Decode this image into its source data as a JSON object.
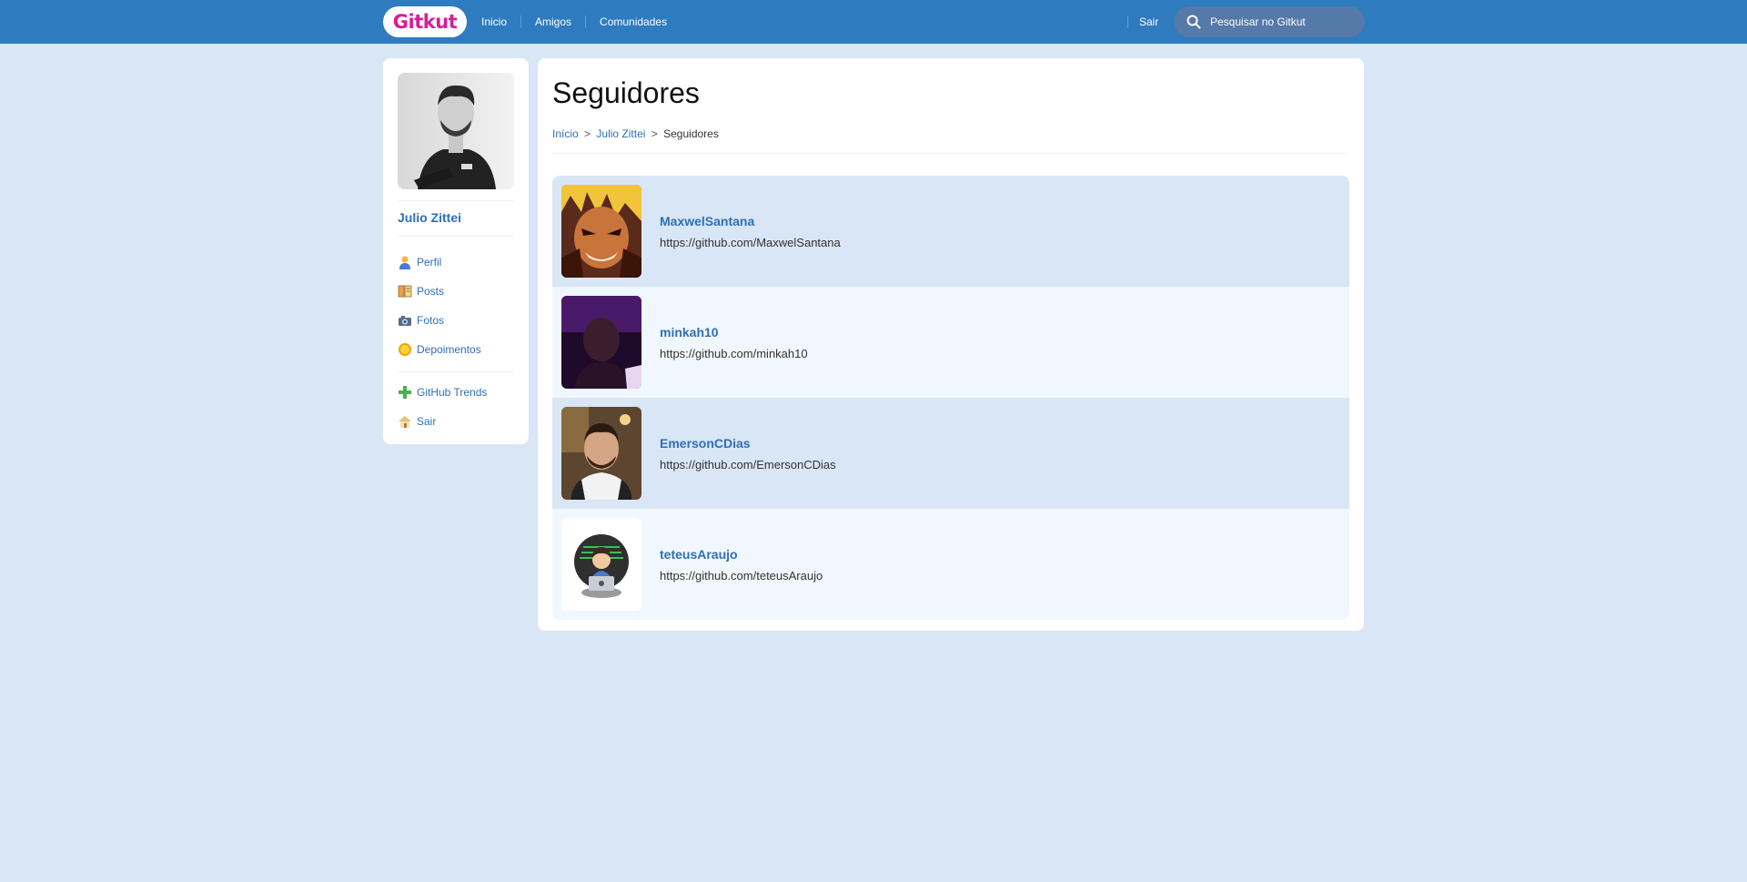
{
  "topbar": {
    "logo": "Gitkut",
    "nav": [
      "Inicio",
      "Amigos",
      "Comunidades"
    ],
    "logout": "Sair",
    "search_placeholder": "Pesquisar no Gitkut"
  },
  "sidebar": {
    "user_name": "Julio Zittei",
    "menu_primary": [
      {
        "label": "Perfil",
        "icon": "user-icon"
      },
      {
        "label": "Posts",
        "icon": "book-icon"
      },
      {
        "label": "Fotos",
        "icon": "camera-icon"
      },
      {
        "label": "Depoimentos",
        "icon": "sun-icon"
      }
    ],
    "menu_secondary": [
      {
        "label": "GitHub Trends",
        "icon": "plus-icon"
      },
      {
        "label": "Sair",
        "icon": "home-icon"
      }
    ]
  },
  "main": {
    "title": "Seguidores",
    "breadcrumb": {
      "home": "Início",
      "user": "Julio Zittei",
      "current": "Seguidores",
      "sep": ">"
    },
    "followers": [
      {
        "name": "MaxwelSantana",
        "url": "https://github.com/MaxwelSantana"
      },
      {
        "name": "minkah10",
        "url": "https://github.com/minkah10"
      },
      {
        "name": "EmersonCDias",
        "url": "https://github.com/EmersonCDias"
      },
      {
        "name": "teteusAraujo",
        "url": "https://github.com/teteusAraujo"
      }
    ]
  },
  "colors": {
    "topbar": "#2E7BBF",
    "background": "#D9E6F6",
    "link": "#2E6FB7",
    "logo": "#D81D99"
  }
}
